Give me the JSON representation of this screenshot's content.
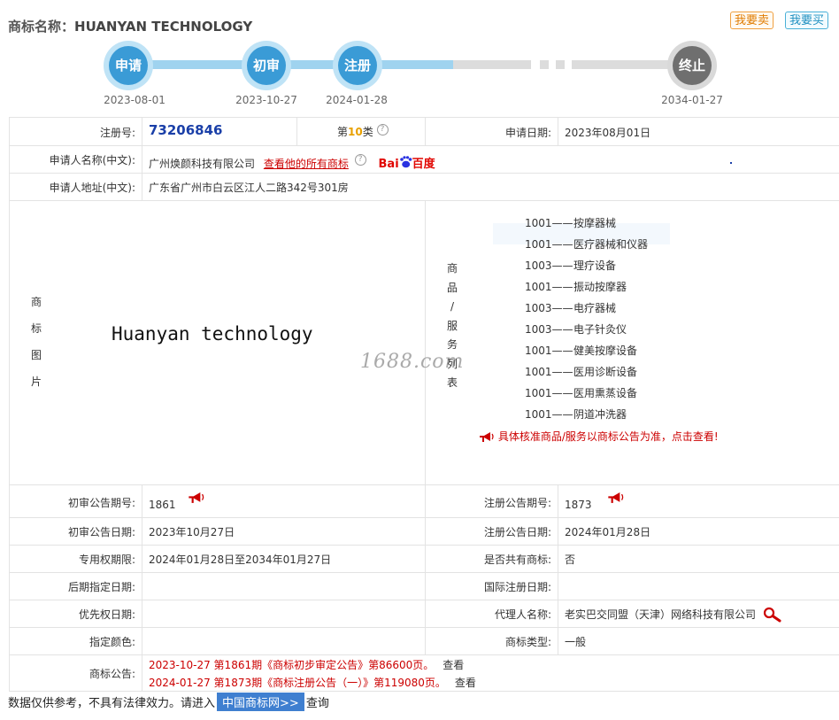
{
  "header": {
    "title_prefix": "商标名称：",
    "title_name": "HUANYAN TECHNOLOGY",
    "sell_label": "我要卖",
    "buy_label": "我要买"
  },
  "timeline": {
    "steps": [
      {
        "label": "申请",
        "date": "2023-08-01",
        "status": "done"
      },
      {
        "label": "初审",
        "date": "2023-10-27",
        "status": "done"
      },
      {
        "label": "注册",
        "date": "2024-01-28",
        "status": "done"
      },
      {
        "label": "终止",
        "date": "2034-01-27",
        "status": "pending"
      }
    ],
    "done_color": "#3a9bd6",
    "pending_color": "#6f6f6f"
  },
  "info": {
    "reg_no_label": "注册号:",
    "reg_no": "73206846",
    "class_prefix": "第",
    "class_num": "10",
    "class_suffix": "类",
    "apply_date_label": "申请日期:",
    "apply_date": "2023年08月01日",
    "applicant_label": "申请人名称(中文):",
    "applicant": "广州焕颜科技有限公司",
    "applicant_link": "查看他的所有商标",
    "baidu_text": "Bai",
    "baidu_cn": "百度",
    "address_label": "申请人地址(中文):",
    "address": "广东省广州市白云区江人二路342号301房",
    "image_label_chars": [
      "商",
      "标",
      "图",
      "片"
    ],
    "image_text": "Huanyan technology",
    "watermark": "1688.com",
    "goods_label_chars": [
      "商",
      "品",
      "/",
      "服",
      "务",
      "列",
      "表"
    ],
    "goods": [
      {
        "code": "1001——",
        "name": "按摩器械"
      },
      {
        "code": "1001——",
        "name": "医疗器械和仪器"
      },
      {
        "code": "1003——",
        "name": "理疗设备"
      },
      {
        "code": "1001——",
        "name": "振动按摩器"
      },
      {
        "code": "1003——",
        "name": "电疗器械"
      },
      {
        "code": "1003——",
        "name": "电子针灸仪"
      },
      {
        "code": "1001——",
        "name": "健美按摩设备"
      },
      {
        "code": "1001——",
        "name": "医用诊断设备"
      },
      {
        "code": "1001——",
        "name": "医用熏蒸设备"
      },
      {
        "code": "1001——",
        "name": "阴道冲洗器"
      }
    ],
    "goods_note": "具体核准商品/服务以商标公告为准，点击查看!",
    "prelim_no_label": "初审公告期号:",
    "prelim_no": "1861",
    "reg_pub_no_label": "注册公告期号:",
    "reg_pub_no": "1873",
    "prelim_date_label": "初审公告日期:",
    "prelim_date": "2023年10月27日",
    "reg_pub_date_label": "注册公告日期:",
    "reg_pub_date": "2024年01月28日",
    "exclusive_label": "专用权期限:",
    "exclusive": "2024年01月28日至2034年01月27日",
    "shared_label": "是否共有商标:",
    "shared": "否",
    "later_date_label": "后期指定日期:",
    "later_date": "",
    "intl_date_label": "国际注册日期:",
    "intl_date": "",
    "priority_label": "优先权日期:",
    "priority": "",
    "agent_label": "代理人名称:",
    "agent": "老实巴交同盟（天津）网络科技有限公司",
    "color_label": "指定颜色:",
    "color": "",
    "type_label": "商标类型:",
    "type": "一般",
    "announce_label": "商标公告:",
    "announcements": [
      {
        "text": "2023-10-27 第1861期《商标初步审定公告》第86600页。",
        "see": "查看"
      },
      {
        "text": "2024-01-27 第1873期《商标注册公告（一）》第119080页。",
        "see": "查看"
      }
    ]
  },
  "footer": {
    "text_before": "数据仅供参考，不具有法律效力。请进入",
    "site_button": "中国商标网>>",
    "text_after": "查询"
  }
}
